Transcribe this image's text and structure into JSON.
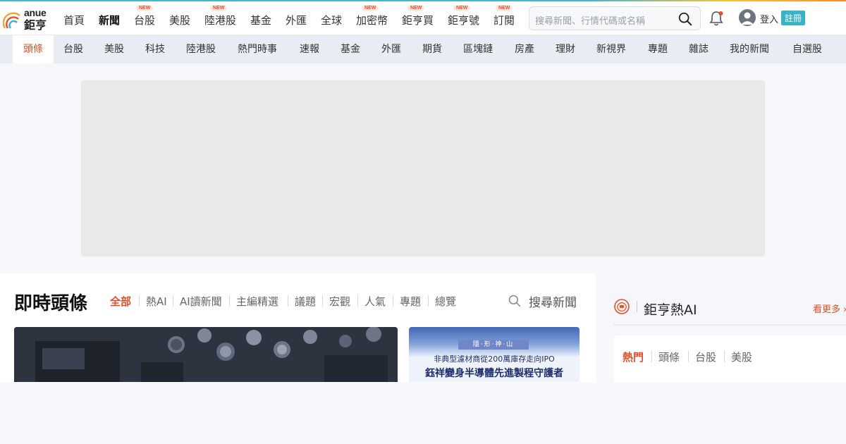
{
  "logo": {
    "top": "anue",
    "bottom": "鉅亨"
  },
  "nav": [
    {
      "label": "首頁"
    },
    {
      "label": "新聞"
    },
    {
      "label": "台股",
      "badge": "NEW"
    },
    {
      "label": "美股"
    },
    {
      "label": "陸港股",
      "badge": "NEW"
    },
    {
      "label": "基金"
    },
    {
      "label": "外匯"
    },
    {
      "label": "全球"
    },
    {
      "label": "加密幣",
      "badge": "NEW"
    },
    {
      "label": "鉅亨買",
      "badge": "NEW"
    },
    {
      "label": "鉅亨號",
      "badge": "NEW"
    },
    {
      "label": "訂閱",
      "badge": "NEW"
    }
  ],
  "search": {
    "placeholder": "搜尋新聞、行情代碼或名稱"
  },
  "user": {
    "login": "登入",
    "register": "註冊"
  },
  "subnav": [
    "頭條",
    "台股",
    "美股",
    "科技",
    "陸港股",
    "熱門時事",
    "速報",
    "基金",
    "外匯",
    "期貨",
    "區塊鏈",
    "房產",
    "理財",
    "新視界",
    "專題",
    "雜誌",
    "我的新聞",
    "自選股"
  ],
  "news": {
    "title": "即時頭條",
    "tabs": [
      "全部",
      "熱AI",
      "AI讀新聞",
      "主編精選",
      "議題",
      "宏觀",
      "人氣",
      "專題",
      "總覽"
    ],
    "search_label": "搜尋新聞",
    "side_image": {
      "tag": "隱·形·神·山",
      "line1": "非典型濾材商從200萬庫存走向IPO",
      "line2": "鈺祥變身半導體先進製程守護者"
    }
  },
  "ai": {
    "title": "鉅亨熱AI",
    "more": "看更多",
    "tabs": [
      "熱門",
      "頭條",
      "台股",
      "美股"
    ]
  },
  "colors": {
    "accent": "#e0502a",
    "brand": "#3bb3c7"
  }
}
